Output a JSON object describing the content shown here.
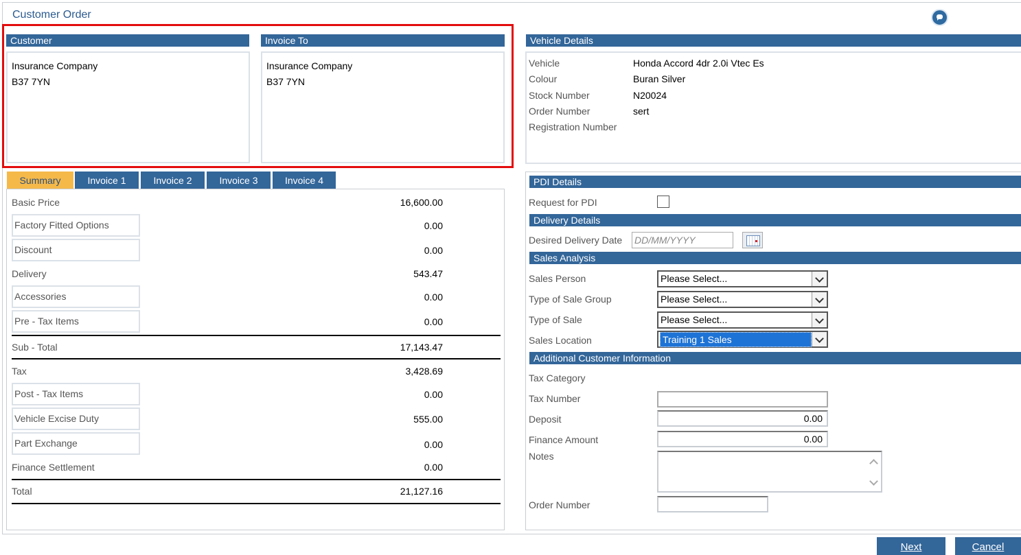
{
  "window": {
    "title": "Customer Order"
  },
  "customer": {
    "header": "Customer",
    "lines": [
      "Insurance Company",
      "B37 7YN"
    ]
  },
  "invoice_to": {
    "header": "Invoice To",
    "lines": [
      "Insurance Company",
      "B37 7YN"
    ]
  },
  "vehicle": {
    "header": "Vehicle Details",
    "rows": [
      {
        "label": "Vehicle",
        "value": "Honda Accord 4dr 2.0i Vtec Es"
      },
      {
        "label": "Colour",
        "value": "Buran Silver"
      },
      {
        "label": "Stock Number",
        "value": "N20024"
      },
      {
        "label": "Order Number",
        "value": "sert"
      },
      {
        "label": "Registration Number",
        "value": ""
      }
    ]
  },
  "tabs": [
    "Summary",
    "Invoice 1",
    "Invoice 2",
    "Invoice 3",
    "Invoice 4"
  ],
  "active_tab": "Summary",
  "summary": {
    "basic_price": {
      "label": "Basic Price",
      "value": "16,600.00"
    },
    "factory_options": {
      "label": "Factory Fitted Options",
      "value": "0.00"
    },
    "discount": {
      "label": "Discount",
      "value": "0.00"
    },
    "delivery": {
      "label": "Delivery",
      "value": "543.47"
    },
    "accessories": {
      "label": "Accessories",
      "value": "0.00"
    },
    "pre_tax": {
      "label": "Pre - Tax Items",
      "value": "0.00"
    },
    "subtotal": {
      "label": "Sub - Total",
      "value": "17,143.47"
    },
    "tax": {
      "label": "Tax",
      "value": "3,428.69"
    },
    "post_tax": {
      "label": "Post - Tax Items",
      "value": "0.00"
    },
    "excise": {
      "label": "Vehicle Excise Duty",
      "value": "555.00"
    },
    "part_exchange": {
      "label": "Part Exchange",
      "value": "0.00"
    },
    "finance_settlement": {
      "label": "Finance Settlement",
      "value": "0.00"
    },
    "total": {
      "label": "Total",
      "value": "21,127.16"
    }
  },
  "pdi": {
    "header": "PDI Details",
    "request_label": "Request for PDI",
    "request_checked": false
  },
  "delivery": {
    "header": "Delivery Details",
    "date_label": "Desired Delivery Date",
    "date_placeholder": "DD/MM/YYYY"
  },
  "sales": {
    "header": "Sales Analysis",
    "person": {
      "label": "Sales Person",
      "value": "Please Select..."
    },
    "group": {
      "label": "Type of Sale Group",
      "value": "Please Select..."
    },
    "type": {
      "label": "Type of Sale",
      "value": "Please Select..."
    },
    "location": {
      "label": "Sales Location",
      "value": "Training 1 Sales"
    }
  },
  "additional": {
    "header": "Additional Customer Information",
    "tax_category": {
      "label": "Tax Category"
    },
    "tax_number": {
      "label": "Tax Number",
      "value": ""
    },
    "deposit": {
      "label": "Deposit",
      "value": "0.00"
    },
    "finance_amount": {
      "label": "Finance Amount",
      "value": "0.00"
    },
    "notes": {
      "label": "Notes",
      "value": ""
    },
    "order_number": {
      "label": "Order Number",
      "value": ""
    }
  },
  "buttons": {
    "next": "Next",
    "cancel": "Cancel"
  },
  "colors": {
    "header_blue": "#336699",
    "active_tab": "#f5b94a",
    "highlight_red": "#e30c0c",
    "selection_blue": "#1e73d6"
  }
}
